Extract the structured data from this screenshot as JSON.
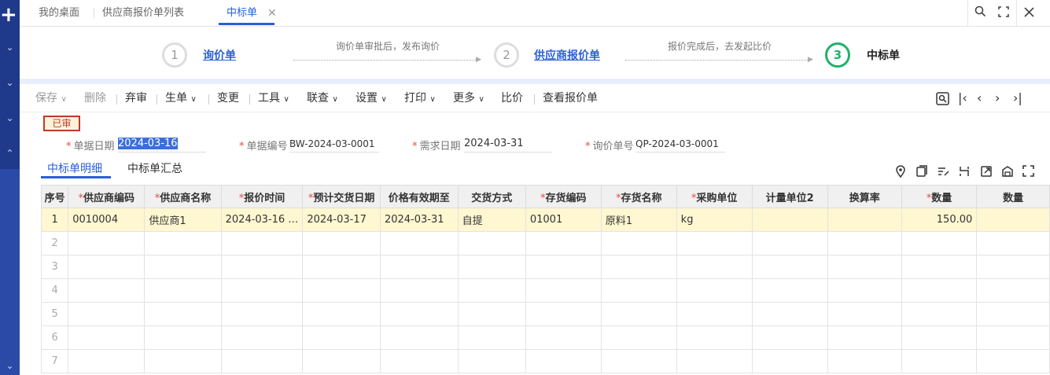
{
  "tabs": [
    {
      "label": "我的桌面"
    },
    {
      "label": "供应商报价单列表"
    },
    {
      "label": "中标单"
    }
  ],
  "window_icons": [
    "search-icon",
    "fullscreen-icon",
    "close-icon"
  ],
  "steps": {
    "items": [
      {
        "number": "1",
        "label": "询价单"
      },
      {
        "number": "2",
        "label": "供应商报价单"
      },
      {
        "number": "3",
        "label": "中标单"
      }
    ],
    "arrow_texts": [
      "询价单审批后，发布询价",
      "报价完成后，去发起比价"
    ]
  },
  "toolbar": {
    "save": "保存",
    "delete": "删除",
    "abandon": "弃审",
    "generate": "生单",
    "change": "变更",
    "tools": "工具",
    "linked_query": "联查",
    "settings": "设置",
    "print": "打印",
    "more": "更多",
    "compare": "比价",
    "view_quote": "查看报价单"
  },
  "status_badge": "已审",
  "form": {
    "doc_date_label": "单据日期",
    "doc_date": "2024-03-16",
    "doc_no_label": "单据编号",
    "doc_no": "BW-2024-03-0001",
    "demand_date_label": "需求日期",
    "demand_date": "2024-03-31",
    "inquiry_no_label": "询价单号",
    "inquiry_no": "QP-2024-03-0001"
  },
  "subtabs": [
    "中标单明细",
    "中标单汇总"
  ],
  "grid": {
    "columns": [
      {
        "label": "序号",
        "required": false
      },
      {
        "label": "供应商编码",
        "required": true
      },
      {
        "label": "供应商名称",
        "required": true
      },
      {
        "label": "报价时间",
        "required": true
      },
      {
        "label": "预计交货日期",
        "required": true
      },
      {
        "label": "价格有效期至",
        "required": false
      },
      {
        "label": "交货方式",
        "required": false
      },
      {
        "label": "存货编码",
        "required": true
      },
      {
        "label": "存货名称",
        "required": true
      },
      {
        "label": "采购单位",
        "required": true
      },
      {
        "label": "计量单位2",
        "required": false
      },
      {
        "label": "换算率",
        "required": false
      },
      {
        "label": "数量",
        "required": true
      },
      {
        "label": "数量",
        "required": false
      }
    ],
    "rows": [
      [
        "1",
        "0010004",
        "供应商1",
        "2024-03-16 …",
        "2024-03-17",
        "2024-03-31",
        "自提",
        "01001",
        "原料1",
        "kg",
        "",
        "",
        "150.00",
        ""
      ],
      [
        "2",
        "",
        "",
        "",
        "",
        "",
        "",
        "",
        "",
        "",
        "",
        "",
        "",
        ""
      ],
      [
        "3",
        "",
        "",
        "",
        "",
        "",
        "",
        "",
        "",
        "",
        "",
        "",
        "",
        ""
      ],
      [
        "4",
        "",
        "",
        "",
        "",
        "",
        "",
        "",
        "",
        "",
        "",
        "",
        "",
        ""
      ],
      [
        "5",
        "",
        "",
        "",
        "",
        "",
        "",
        "",
        "",
        "",
        "",
        "",
        "",
        ""
      ],
      [
        "6",
        "",
        "",
        "",
        "",
        "",
        "",
        "",
        "",
        "",
        "",
        "",
        "",
        ""
      ],
      [
        "7",
        "",
        "",
        "",
        "",
        "",
        "",
        "",
        "",
        "",
        "",
        "",
        "",
        ""
      ]
    ]
  },
  "colors": {
    "accent": "#2a5fd6",
    "sidebar": "#1f3a8a",
    "step_done": "#1fb26a",
    "highlight_row": "#fff7d1",
    "badge_border": "#c0392b"
  }
}
